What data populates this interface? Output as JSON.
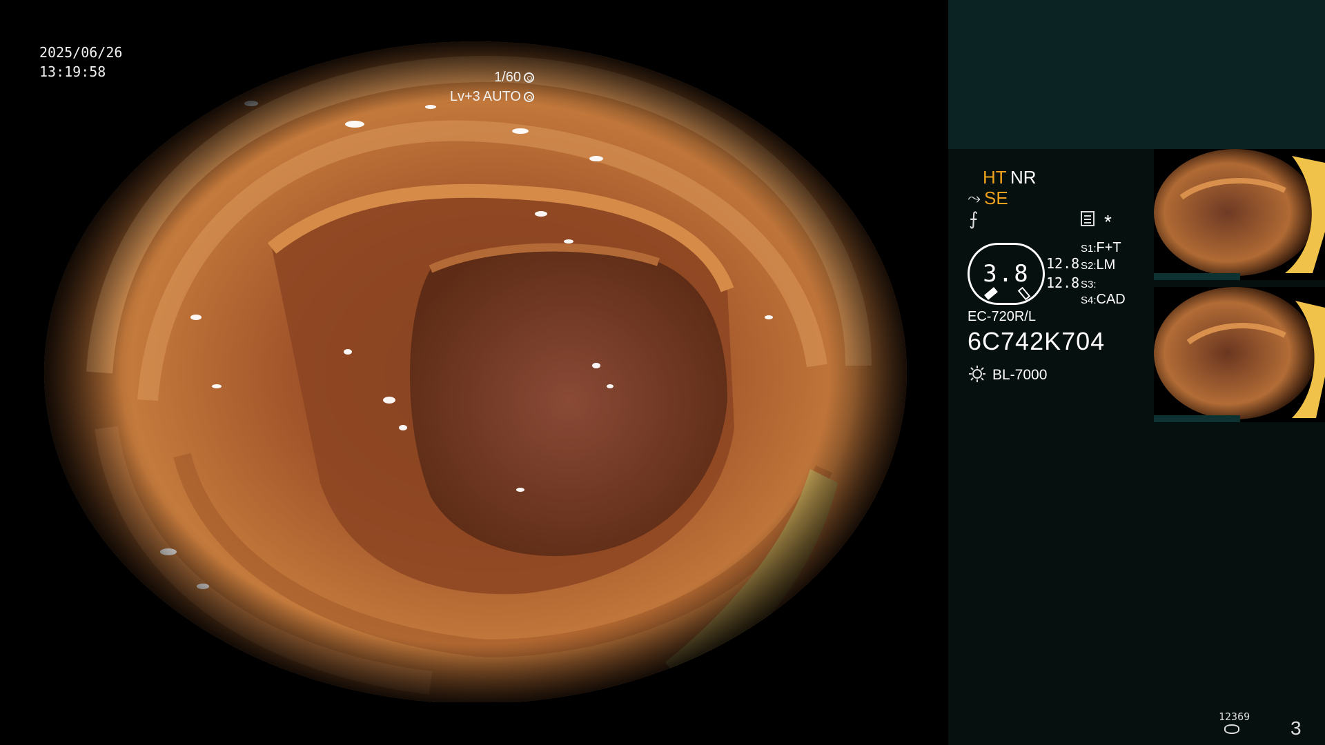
{
  "overlay": {
    "date": "2025/06/26",
    "time": "13:19:58",
    "shutter": "1/60",
    "level": "Lv+3",
    "mode": "AUTO"
  },
  "panel": {
    "indicators": {
      "ht": "HT",
      "nr": "NR",
      "se": "SE",
      "asterisk": "*"
    },
    "gauge": {
      "value": "3.8",
      "upper": "12.8",
      "lower": "12.8"
    },
    "switches": [
      {
        "key": "S1:",
        "value": "F+T"
      },
      {
        "key": "S2:",
        "value": "LM"
      },
      {
        "key": "S3:",
        "value": ""
      },
      {
        "key": "S4:",
        "value": "CAD"
      }
    ],
    "scope_model": "EC-720R/L",
    "scope_serial": "6C742K704",
    "light_source": "BL-7000",
    "icons": [
      "scope-angle-icon",
      "sharpness-icon",
      "record-doc-icon",
      "light-source-icon",
      "storage-icon"
    ]
  },
  "footer": {
    "count": "12369",
    "page": "3"
  },
  "colors": {
    "accent_orange": "#f0a21e",
    "panel_top": "#0b2423",
    "panel_body": "#06100f",
    "tissue": "#b8642a"
  }
}
